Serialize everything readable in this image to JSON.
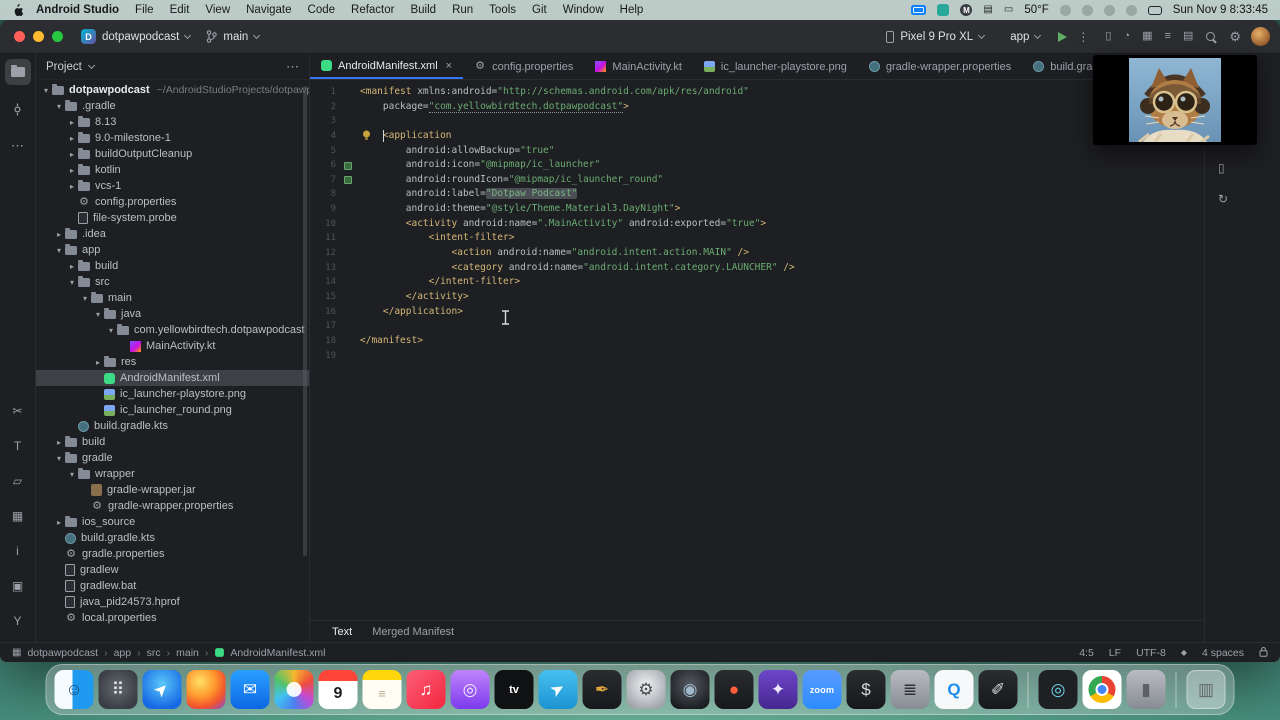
{
  "colors": {
    "accent": "#3574f0",
    "run_green": "#5fad65",
    "tag": "#d5b778",
    "string": "#6aab73",
    "selection": "#3d4146",
    "android_green": "#3ddc84"
  },
  "menubar": {
    "app_name": "Android Studio",
    "menus": [
      "File",
      "Edit",
      "View",
      "Navigate",
      "Code",
      "Refactor",
      "Build",
      "Run",
      "Tools",
      "Git",
      "Window",
      "Help"
    ],
    "status_icons": [
      {
        "name": "screen-mirroring-icon",
        "cls": "mi-mirror"
      },
      {
        "name": "teal-app-badge-icon",
        "cls": "mi-teal"
      },
      {
        "name": "m-badge-icon",
        "cls": "mi-m",
        "g": "M"
      },
      {
        "name": "keyboard-icon",
        "cls": "mi-plain",
        "g": "▤"
      },
      {
        "name": "display-icon",
        "cls": "mi-plain",
        "g": "▭"
      },
      {
        "name": "temperature",
        "text": "50°F"
      },
      {
        "name": "menu-extra-icon-1",
        "cls": "mi-dot"
      },
      {
        "name": "menu-extra-icon-2",
        "cls": "mi-dot"
      },
      {
        "name": "menu-extra-icon-3",
        "cls": "mi-dot"
      },
      {
        "name": "menu-extra-icon-4",
        "cls": "mi-dot"
      },
      {
        "name": "control-center-icon",
        "cls": "mi-cc"
      },
      {
        "name": "clock",
        "text": "Sun Nov 9 8:33:45"
      }
    ]
  },
  "titlebar": {
    "project_name": "dotpawpodcast",
    "project_initial": "D",
    "branch": "main",
    "device": "Pixel 9 Pro XL",
    "run_config": "app",
    "right_icons": [
      {
        "name": "device-mirror-icon",
        "g": "▯"
      },
      {
        "name": "build-analyzer-icon",
        "g": "◔"
      },
      {
        "name": "grid-view-icon",
        "g": "▦"
      },
      {
        "name": "layout-inspector-icon",
        "g": "≡"
      },
      {
        "name": "notifications-icon",
        "g": "▤"
      },
      {
        "name": "search-icon",
        "k": "mag"
      },
      {
        "name": "settings-gear-icon",
        "k": "gear"
      }
    ]
  },
  "left_stripe": {
    "top": [
      {
        "name": "project-tool-icon",
        "k": "folder",
        "active": true
      },
      {
        "name": "commit-tool-icon",
        "k": "commit"
      },
      {
        "name": "more-tool-windows-icon",
        "k": "dots"
      }
    ],
    "bottom": [
      {
        "name": "cut-tool-icon",
        "g": "✂"
      },
      {
        "name": "text-tool-icon",
        "g": "T"
      },
      {
        "name": "copy-tool-icon",
        "g": "▱"
      },
      {
        "name": "grid-tool-icon",
        "g": "▦"
      },
      {
        "name": "info-tool-icon",
        "g": "i"
      },
      {
        "name": "package-tool-icon",
        "g": "▣"
      },
      {
        "name": "vcs-branch-icon",
        "g": "Y"
      }
    ]
  },
  "right_stripe": [
    {
      "name": "running-devices-icon",
      "g": "▭"
    },
    {
      "name": "ai-assistant-icon",
      "g": "✦"
    },
    {
      "name": "gradle-tool-icon",
      "g": "◔"
    },
    {
      "name": "device-manager-icon",
      "g": "▯"
    },
    {
      "name": "sync-icon",
      "g": "↻"
    }
  ],
  "project_panel": {
    "title": "Project",
    "tree": [
      {
        "l": "dotpawpodcast",
        "sub": "~/AndroidStudioProjects/dotpawpodcast",
        "d": 0,
        "t": "folder",
        "e": "open",
        "root": true
      },
      {
        "l": ".gradle",
        "d": 1,
        "t": "folder",
        "e": "open"
      },
      {
        "l": "8.13",
        "d": 2,
        "t": "folder",
        "e": "closed"
      },
      {
        "l": "9.0-milestone-1",
        "d": 2,
        "t": "folder",
        "e": "closed"
      },
      {
        "l": "buildOutputCleanup",
        "d": 2,
        "t": "folder",
        "e": "closed"
      },
      {
        "l": "kotlin",
        "d": 2,
        "t": "folder",
        "e": "closed"
      },
      {
        "l": "vcs-1",
        "d": 2,
        "t": "folder",
        "e": "closed"
      },
      {
        "l": "config.properties",
        "d": 2,
        "t": "props"
      },
      {
        "l": "file-system.probe",
        "d": 2,
        "t": "file"
      },
      {
        "l": ".idea",
        "d": 1,
        "t": "folder",
        "e": "closed"
      },
      {
        "l": "app",
        "d": 1,
        "t": "folder",
        "e": "open"
      },
      {
        "l": "build",
        "d": 2,
        "t": "folder",
        "e": "closed"
      },
      {
        "l": "src",
        "d": 2,
        "t": "folder",
        "e": "open"
      },
      {
        "l": "main",
        "d": 3,
        "t": "folder",
        "e": "open"
      },
      {
        "l": "java",
        "d": 4,
        "t": "folder",
        "e": "open"
      },
      {
        "l": "com.yellowbirdtech.dotpawpodcast",
        "d": 5,
        "t": "package",
        "e": "open"
      },
      {
        "l": "MainActivity.kt",
        "d": 6,
        "t": "kotlin"
      },
      {
        "l": "res",
        "d": 4,
        "t": "folder",
        "e": "closed"
      },
      {
        "l": "AndroidManifest.xml",
        "d": 4,
        "t": "android",
        "sel": true
      },
      {
        "l": "ic_launcher-playstore.png",
        "d": 4,
        "t": "image"
      },
      {
        "l": "ic_launcher_round.png",
        "d": 4,
        "t": "image"
      },
      {
        "l": "build.gradle.kts",
        "d": 2,
        "t": "gradle"
      },
      {
        "l": "build",
        "d": 1,
        "t": "folder",
        "e": "closed"
      },
      {
        "l": "gradle",
        "d": 1,
        "t": "folder",
        "e": "open"
      },
      {
        "l": "wrapper",
        "d": 2,
        "t": "folder",
        "e": "open"
      },
      {
        "l": "gradle-wrapper.jar",
        "d": 3,
        "t": "jar"
      },
      {
        "l": "gradle-wrapper.properties",
        "d": 3,
        "t": "props"
      },
      {
        "l": "ios_source",
        "d": 1,
        "t": "folder",
        "e": "closed"
      },
      {
        "l": "build.gradle.kts",
        "d": 1,
        "t": "gradle"
      },
      {
        "l": "gradle.properties",
        "d": 1,
        "t": "props"
      },
      {
        "l": "gradlew",
        "d": 1,
        "t": "script"
      },
      {
        "l": "gradlew.bat",
        "d": 1,
        "t": "script"
      },
      {
        "l": "java_pid24573.hprof",
        "d": 1,
        "t": "file"
      },
      {
        "l": "local.properties",
        "d": 1,
        "t": "props"
      }
    ]
  },
  "tabs": [
    {
      "label": "AndroidManifest.xml",
      "icon": "android",
      "active": true,
      "close": true
    },
    {
      "label": "config.properties",
      "icon": "props"
    },
    {
      "label": "MainActivity.kt",
      "icon": "kotlin"
    },
    {
      "label": "ic_launcher-playstore.png",
      "icon": "image"
    },
    {
      "label": "gradle-wrapper.properties",
      "icon": "gradle"
    },
    {
      "label": "build.gradle.kts (:dotpawpo",
      "icon": "gradle"
    }
  ],
  "editor": {
    "caret": {
      "line": 4,
      "col": 5
    },
    "lines": [
      {
        "n": 1,
        "t": [
          [
            "t",
            "<manifest "
          ],
          [
            "a",
            "xmlns:android="
          ],
          [
            "s",
            "\"http://schemas.android.com/apk/res/android\""
          ]
        ]
      },
      {
        "n": 2,
        "t": [
          [
            "a",
            "    package="
          ],
          [
            "su",
            "\"com.yellowbirdtech.dotpawpodcast\""
          ],
          [
            "t",
            ">"
          ]
        ]
      },
      {
        "n": 3,
        "t": []
      },
      {
        "n": 4,
        "t": [
          [
            "t",
            "    <application"
          ]
        ],
        "bulb": true
      },
      {
        "n": 5,
        "t": [
          [
            "a",
            "        android:allowBackup="
          ],
          [
            "s",
            "\"true\""
          ]
        ]
      },
      {
        "n": 6,
        "t": [
          [
            "a",
            "        android:icon="
          ],
          [
            "s",
            "\"@mipmap/ic_launcher\""
          ]
        ],
        "g": true
      },
      {
        "n": 7,
        "t": [
          [
            "a",
            "        android:roundIcon="
          ],
          [
            "s",
            "\"@mipmap/ic_launcher_round\""
          ]
        ],
        "g": true
      },
      {
        "n": 8,
        "t": [
          [
            "a",
            "        android:label="
          ],
          [
            "sh",
            "\"Dotpaw Podcast\""
          ]
        ]
      },
      {
        "n": 9,
        "t": [
          [
            "a",
            "        android:theme="
          ],
          [
            "s",
            "\"@style/Theme.Material3.DayNight\""
          ],
          [
            "t",
            ">"
          ]
        ]
      },
      {
        "n": 10,
        "t": [
          [
            "t",
            "        <activity "
          ],
          [
            "a",
            "android:name="
          ],
          [
            "s",
            "\".MainActivity\""
          ],
          [
            "a",
            " android:exported="
          ],
          [
            "s",
            "\"true\""
          ],
          [
            "t",
            ">"
          ]
        ]
      },
      {
        "n": 11,
        "t": [
          [
            "t",
            "            <intent-filter>"
          ]
        ]
      },
      {
        "n": 12,
        "t": [
          [
            "t",
            "                <action "
          ],
          [
            "a",
            "android:name="
          ],
          [
            "s",
            "\"android.intent.action.MAIN\""
          ],
          [
            "t",
            " />"
          ]
        ]
      },
      {
        "n": 13,
        "t": [
          [
            "t",
            "                <category "
          ],
          [
            "a",
            "android:name="
          ],
          [
            "s",
            "\"android.intent.category.LAUNCHER\""
          ],
          [
            "t",
            " />"
          ]
        ]
      },
      {
        "n": 14,
        "t": [
          [
            "t",
            "            </intent-filter>"
          ]
        ]
      },
      {
        "n": 15,
        "t": [
          [
            "t",
            "        </activity>"
          ]
        ]
      },
      {
        "n": 16,
        "t": [
          [
            "t",
            "    </application>"
          ]
        ]
      },
      {
        "n": 17,
        "t": []
      },
      {
        "n": 18,
        "t": [
          [
            "t",
            "</manifest>"
          ]
        ]
      },
      {
        "n": 19,
        "t": []
      }
    ]
  },
  "bottom_tabs": [
    {
      "label": "Text",
      "active": true
    },
    {
      "label": "Merged Manifest",
      "active": false
    }
  ],
  "statusbar": {
    "breadcrumbs": [
      "dotpawpodcast",
      "app",
      "src",
      "main",
      "AndroidManifest.xml"
    ],
    "caret_pos": "4:5",
    "line_ending": "LF",
    "encoding": "UTF-8",
    "indent_icon": "◆",
    "indent": "4 spaces"
  },
  "pip": {
    "name": "facecam-cat-overlay"
  },
  "dock": {
    "items": [
      {
        "name": "finder",
        "cls": "d-finder",
        "g": "☺",
        "fg": "#14466b"
      },
      {
        "name": "launchpad",
        "cls": "d-launchpad",
        "g": "⠿",
        "fg": "#e8eaed"
      },
      {
        "name": "safari",
        "cls": "d-safari",
        "g": "➤",
        "fg": "#ffffff",
        "rot": -45
      },
      {
        "name": "firefox",
        "cls": "d-firefox",
        "g": "",
        "fg": ""
      },
      {
        "name": "mail",
        "cls": "d-mail",
        "g": "✉",
        "fg": "#ffffff"
      },
      {
        "name": "photos",
        "cls": "d-photos",
        "g": "",
        "fg": ""
      },
      {
        "name": "calendar",
        "cls": "d-cal",
        "g": "9",
        "fg": "#1d1d1f"
      },
      {
        "name": "notes",
        "cls": "d-notes",
        "g": "≡",
        "fg": "#b5b08e"
      },
      {
        "name": "music",
        "cls": "d-music",
        "g": "♫",
        "fg": "#ffffff"
      },
      {
        "name": "podcasts",
        "cls": "d-podcasts",
        "g": "◎",
        "fg": "#f2e7ff"
      },
      {
        "name": "apple-tv",
        "cls": "d-tv",
        "g": "tv",
        "fg": "#ffffff"
      },
      {
        "name": "telegram",
        "cls": "d-telegram",
        "g": "➤",
        "fg": "#ffffff",
        "rot": -30
      },
      {
        "name": "design-tool",
        "cls": "d-dark",
        "g": "✒",
        "fg": "#e0a43c"
      },
      {
        "name": "system-settings",
        "cls": "d-settings",
        "g": "⚙",
        "fg": "#4a4d52"
      },
      {
        "name": "lens-app",
        "cls": "d-lens",
        "g": "◉",
        "fg": "#9fb8cc"
      },
      {
        "name": "red-orb-app",
        "cls": "d-dark",
        "g": "●",
        "fg": "#ff5e3a"
      },
      {
        "name": "star-app",
        "cls": "d-star",
        "g": "✦",
        "fg": "#efe9ff"
      },
      {
        "name": "zoom",
        "cls": "d-zoom",
        "g": "zoom",
        "fg": "#ffffff"
      },
      {
        "name": "terminal",
        "cls": "d-dark",
        "g": "$",
        "fg": "#d7dadf"
      },
      {
        "name": "list-app",
        "cls": "d-gray",
        "g": "≣",
        "fg": "#2e3135"
      },
      {
        "name": "quicktime",
        "cls": "d-white",
        "g": "Q",
        "fg": "#1d8ef0"
      },
      {
        "name": "pen-app",
        "cls": "d-dark",
        "g": "✐",
        "fg": "#d9dbe0"
      },
      {
        "divider": true
      },
      {
        "name": "android-studio",
        "cls": "d-as",
        "g": "◎",
        "fg": "#67d1e6"
      },
      {
        "name": "chrome",
        "cls": "d-chrome",
        "g": "",
        "fg": ""
      },
      {
        "name": "archive-app",
        "cls": "d-gray",
        "g": "▮",
        "fg": "#5c6066"
      },
      {
        "divider": true
      },
      {
        "name": "trash",
        "cls": "d-trash",
        "g": "▥",
        "fg": "#63676d"
      }
    ]
  }
}
